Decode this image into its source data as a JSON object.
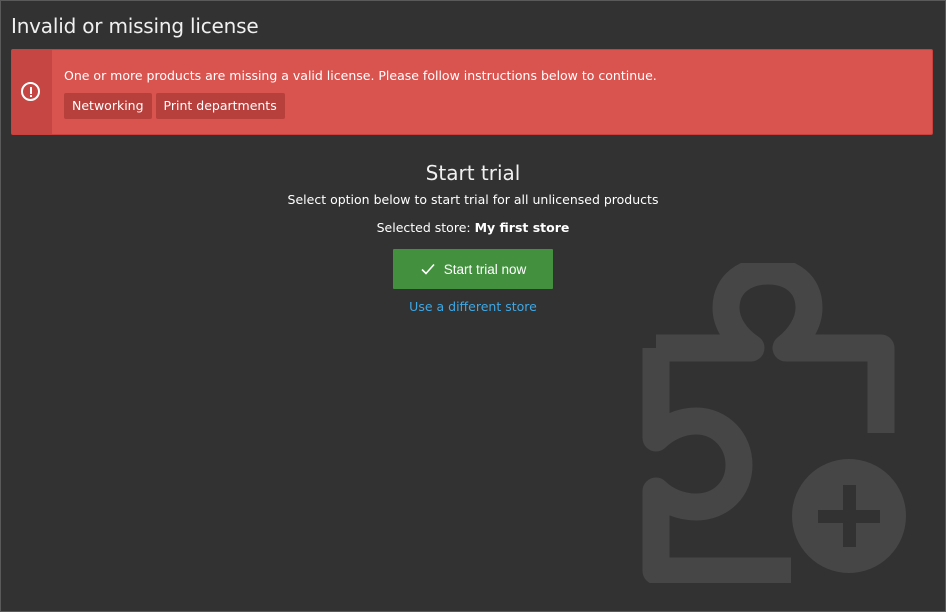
{
  "window": {
    "title": "Invalid or missing license"
  },
  "alert": {
    "icon": "exclamation-circle-icon",
    "message": "One or more products are missing a valid license. Please follow instructions below to continue.",
    "products": [
      "Networking",
      "Print departments"
    ],
    "color": "#d9534f"
  },
  "trial": {
    "heading": "Start trial",
    "subtitle": "Select option below to start trial for all unlicensed products",
    "store_label": "Selected store: ",
    "store_name": "My first store",
    "start_button": {
      "label": "Start trial now",
      "icon": "check-icon",
      "color": "#43913f"
    },
    "change_store_link": "Use a different store"
  },
  "background_icon": "puzzle-plus-icon"
}
